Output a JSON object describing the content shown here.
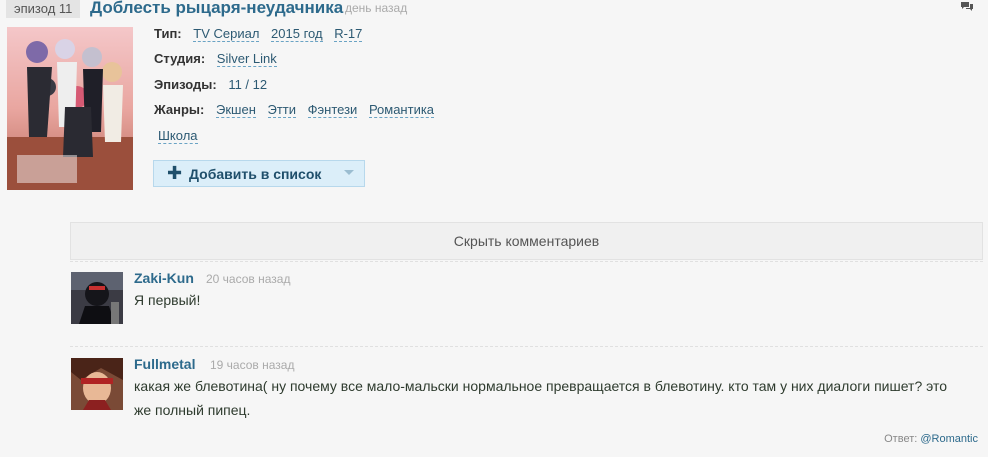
{
  "header": {
    "episode_label": "эпизод 11",
    "title": "Доблесть рыцаря-неудачника",
    "time_ago": "день назад"
  },
  "info": {
    "type_label": "Тип:",
    "type_tags": [
      "TV Сериал",
      "2015 год",
      "R-17"
    ],
    "studio_label": "Студия:",
    "studio": "Silver Link",
    "episodes_label": "Эпизоды:",
    "episodes": "11 / 12",
    "genres_label": "Жанры:",
    "genres": [
      "Экшен",
      "Этти",
      "Фэнтези",
      "Романтика",
      "Школа"
    ]
  },
  "add_button": {
    "label": "Добавить в список"
  },
  "comments": {
    "toggle_label": "Скрыть комментариев",
    "items": [
      {
        "author": "Zaki-Kun",
        "time": "20 часов назад",
        "text": "Я первый!"
      },
      {
        "author": "Fullmetal",
        "time": "19 часов назад",
        "text_line1": "какая же блевотина( ну почему все мало-мальски нормальное превращается в блевотину. кто там у них диалоги пишет? это",
        "text_line2": "же полный пипец."
      }
    ],
    "reply_prefix": "Ответ:",
    "reply_to": "@Romantic"
  },
  "icons": {
    "comments": "comments-icon",
    "plus": "plus-icon",
    "caret": "caret-down-icon"
  },
  "colors": {
    "link": "#2d6a8c",
    "button_bg": "#dbeef9"
  }
}
